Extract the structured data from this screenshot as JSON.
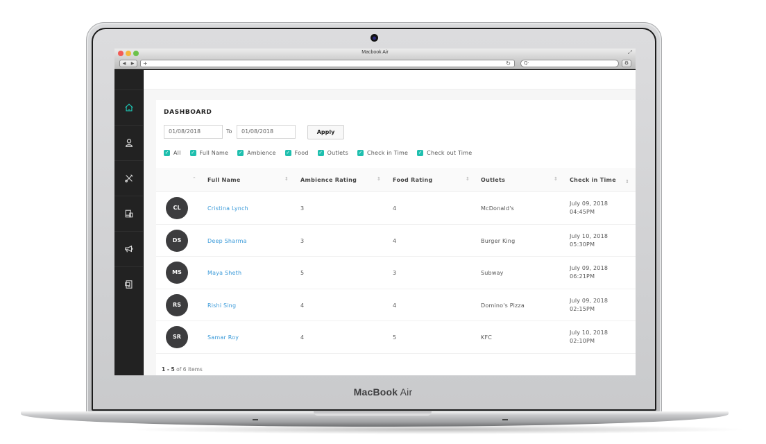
{
  "device": {
    "brand_bold": "MacBook",
    "brand_light": "Air"
  },
  "browser": {
    "window_title": "Macbook Air",
    "url_value": "",
    "search_placeholder": "Q·",
    "back_label": "◀",
    "forward_label": "▶",
    "new_tab_label": "+",
    "reload_icon": "↻",
    "settings_icon": "⚙",
    "traffic_colors": {
      "close": "#f25b55",
      "minimize": "#f5b83b",
      "zoom": "#6cc24a"
    }
  },
  "sidebar": {
    "active_color": "#1ebfae",
    "items": [
      {
        "icon": "home-icon",
        "active": true
      },
      {
        "icon": "user-icon",
        "active": false
      },
      {
        "icon": "tools-icon",
        "active": false
      },
      {
        "icon": "devices-icon",
        "active": false
      },
      {
        "icon": "megaphone-icon",
        "active": false
      },
      {
        "icon": "document-icon",
        "active": false
      }
    ]
  },
  "dashboard": {
    "title": "DASHBOARD",
    "from_date": "01/08/2018",
    "to_label": "To",
    "to_date": "01/08/2018",
    "apply_label": "Apply",
    "checkbox_color": "#1ebfae",
    "filters": [
      {
        "label": "All",
        "checked": true
      },
      {
        "label": "Full Name",
        "checked": true
      },
      {
        "label": "Ambience",
        "checked": true
      },
      {
        "label": "Food",
        "checked": true
      },
      {
        "label": "Outlets",
        "checked": true
      },
      {
        "label": "Check in Time",
        "checked": true
      },
      {
        "label": "Check out Time",
        "checked": true
      }
    ]
  },
  "table": {
    "columns": [
      "Full Name",
      "Ambience Rating",
      "Food Rating",
      "Outlets",
      "Check in Time"
    ],
    "rows": [
      {
        "initials": "CL",
        "name": "Cristina Lynch",
        "ambience": "3",
        "food": "4",
        "outlet": "McDonald's",
        "date": "July 09, 2018",
        "time": "04:45PM"
      },
      {
        "initials": "DS",
        "name": "Deep Sharma",
        "ambience": "3",
        "food": "4",
        "outlet": "Burger King",
        "date": "July 10, 2018",
        "time": "05:30PM"
      },
      {
        "initials": "MS",
        "name": "Maya Sheth",
        "ambience": "5",
        "food": "3",
        "outlet": "Subway",
        "date": "July 09, 2018",
        "time": "06:21PM"
      },
      {
        "initials": "RS",
        "name": "Rishi Sing",
        "ambience": "4",
        "food": "4",
        "outlet": "Domino's Pizza",
        "date": "July 09, 2018",
        "time": "02:15PM"
      },
      {
        "initials": "SR",
        "name": "Samar Roy",
        "ambience": "4",
        "food": "5",
        "outlet": "KFC",
        "date": "July 10, 2018",
        "time": "02:10PM"
      }
    ],
    "pager": {
      "range": "1 - 5",
      "suffix": "of 6 items"
    }
  }
}
